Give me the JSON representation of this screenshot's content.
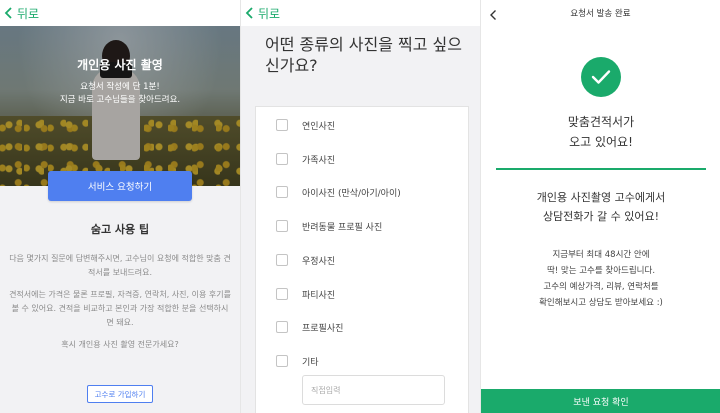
{
  "panel1": {
    "back_label": "뒤로",
    "hero": {
      "title": "개인용 사진 촬영",
      "subtitle_line1": "요청서 작성에 단 1분!",
      "subtitle_line2": "지금 바로 고수님들을 찾아드려요."
    },
    "request_button": "서비스 요청하기",
    "tips_title": "숨고 사용 팁",
    "tips_para1": "다음 몇가지 질문에 답변해주시면, 고수님이 요청에 적합한 맞춤 견적서를 보내드려요.",
    "tips_para2": "견적서에는 가격은 물론 프로필, 자격증, 연락처, 사진, 이용 후기를 볼 수 있어요. 견적을 비교하고 본인과 가장 적합한 분을 선택하시면 돼요.",
    "tips_para3": "혹시 개인용 사진 촬영 전문가세요?",
    "signup_button": "고수로 가입하기"
  },
  "panel2": {
    "back_label": "뒤로",
    "question": "어떤 종류의 사진을 찍고 싶으신가요?",
    "options": [
      {
        "label": "연인사진"
      },
      {
        "label": "가족사진"
      },
      {
        "label": "아이사진 (만삭/아기/아이)"
      },
      {
        "label": "반려동물 프로필 사진"
      },
      {
        "label": "우정사진"
      },
      {
        "label": "파티사진"
      },
      {
        "label": "프로필사진"
      },
      {
        "label": "기타"
      }
    ],
    "direct_input_placeholder": "직접입력"
  },
  "panel3": {
    "title": "요청서 발송 완료",
    "done_line1": "맞춤견적서가",
    "done_line2": "오고 있어요!",
    "sub_line1": "개인용 사진촬영 고수에게서",
    "sub_line2": "상담전화가 갈 수 있어요!",
    "desc_line1": "지금부터 최대 48시간 안에",
    "desc_line2": "딱! 맞는 고수를 찾아드립니다.",
    "desc_line3": "고수의 예상가격, 리뷰, 연락처를",
    "desc_line4": "확인해보시고 상담도 받아보세요 :)",
    "bottom_button": "보낸 요청 확인"
  },
  "colors": {
    "brand_green": "#1aaa6b",
    "primary_blue": "#4f7ff0"
  },
  "icons": [
    "chevron-left-icon",
    "checkmark-icon"
  ]
}
